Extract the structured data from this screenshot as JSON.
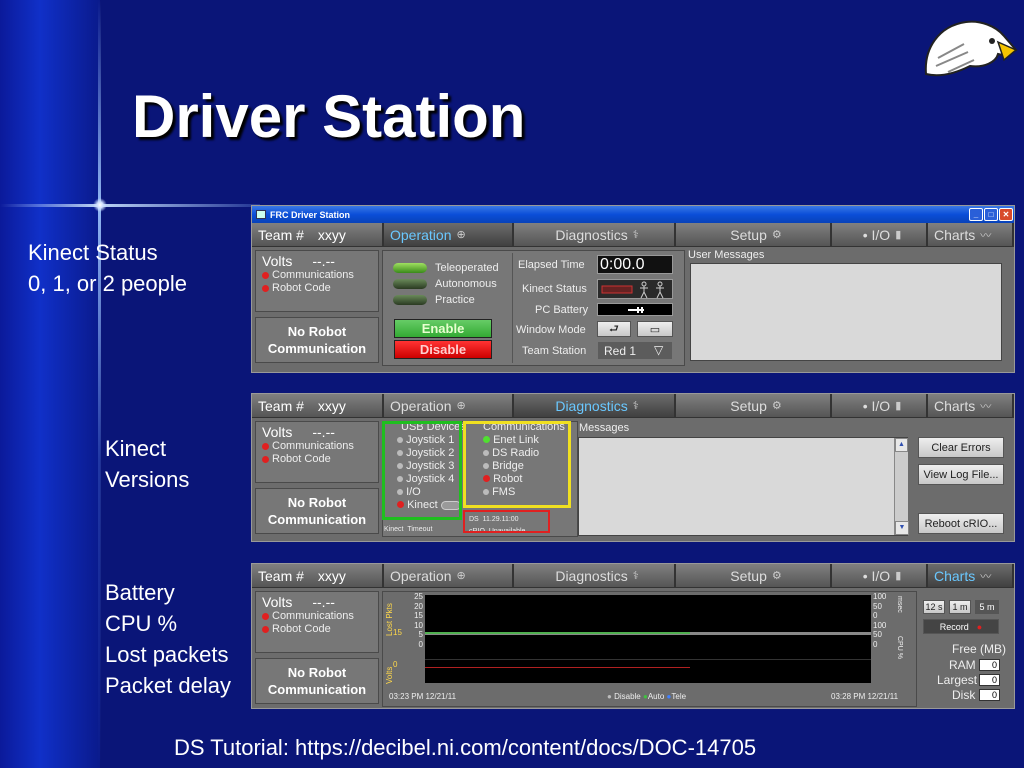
{
  "slide": {
    "title": "Driver Station",
    "annotations": {
      "kinect_status": [
        "Kinect Status",
        "0, 1, or 2 people"
      ],
      "kinect_versions": [
        "Kinect",
        "Versions"
      ],
      "charts_info": [
        "Battery",
        "CPU %",
        "Lost packets",
        "Packet delay"
      ]
    },
    "footer": "DS Tutorial: https://decibel.ni.com/content/docs/DOC-14705"
  },
  "window": {
    "title": "FRC Driver Station"
  },
  "tabs": {
    "team_label": "Team #",
    "team_value": "xxyy",
    "operation": "Operation",
    "diagnostics": "Diagnostics",
    "setup": "Setup",
    "io": "• I/O",
    "charts": "Charts"
  },
  "status": {
    "volts_label": "Volts",
    "volts_value": "--.--",
    "communications": "Communications",
    "robot_code": "Robot Code",
    "no_robot_line1": "No Robot",
    "no_robot_line2": "Communication"
  },
  "operation": {
    "modes": [
      "Teleoperated",
      "Autonomous",
      "Practice"
    ],
    "enable": "Enable",
    "disable": "Disable",
    "elapsed_label": "Elapsed Time",
    "elapsed_value": "0:00.0",
    "kinect_status_label": "Kinect Status",
    "pc_battery_label": "PC Battery",
    "window_mode_label": "Window Mode",
    "team_station_label": "Team Station",
    "team_station_value": "Red 1",
    "user_messages_label": "User Messages"
  },
  "diagnostics": {
    "usb_label": "USB Devices",
    "usb_items": [
      "Joystick 1",
      "Joystick 2",
      "Joystick 3",
      "Joystick 4",
      "I/O",
      "Kinect"
    ],
    "comms_label": "Communications",
    "comms_items": [
      "Enet Link",
      "DS Radio",
      "Bridge",
      "Robot",
      "FMS"
    ],
    "messages_label": "Messages",
    "kinect_label": "Kinect",
    "timeout": "Timeout",
    "ds_label": "DS",
    "ds_date": "11.29.11:00",
    "crio_label": "cRIO",
    "crio_value": "Unavailable",
    "clear_errors": "Clear Errors",
    "view_log": "View Log File...",
    "reboot": "Reboot cRIO..."
  },
  "charts_tab": {
    "lost_pkts_axis": "Lost Pkts",
    "volts_axis": "Volts",
    "msec_axis": "msec",
    "cpu_axis": "CPU %",
    "left_ticks": [
      "25",
      "20",
      "15",
      "10",
      "5",
      "0"
    ],
    "volts_ticks": [
      "15",
      "0"
    ],
    "right_ticks": [
      "100",
      "50",
      "0",
      "100",
      "50",
      "0"
    ],
    "start_time": "03:23 PM 12/21/11",
    "end_time": "03:28 PM 12/21/11",
    "legend": [
      "Disable",
      "Auto",
      "Tele"
    ],
    "legend_colors": [
      "#bbbbbb",
      "#40c040",
      "#4080ff"
    ],
    "ranges": [
      "12 s",
      "1 m",
      "5 m"
    ],
    "record": "Record",
    "free_label": "Free (MB)",
    "ram_label": "RAM",
    "largest_label": "Largest",
    "disk_label": "Disk",
    "ram_value": "0",
    "largest_value": "0",
    "disk_value": "0"
  }
}
